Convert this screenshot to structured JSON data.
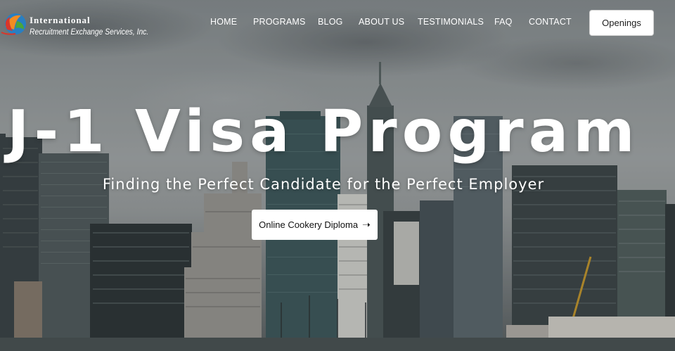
{
  "brand": {
    "line1": "International",
    "line2": "Recruitment Exchange Services, Inc.",
    "colors": {
      "red": "#d8362b",
      "orange": "#f28c22",
      "green": "#4aa63a",
      "blue": "#2a7fc1"
    }
  },
  "nav": {
    "items": [
      {
        "label": "HOME"
      },
      {
        "label": "PROGRAMS"
      },
      {
        "label": "BLOG"
      },
      {
        "label": "ABOUT US"
      },
      {
        "label": "TESTIMONIALS"
      },
      {
        "label": "FAQ"
      },
      {
        "label": "CONTACT"
      }
    ],
    "cta_label": "Openings"
  },
  "hero": {
    "title": "J-1 Visa Program",
    "subtitle": "Finding the Perfect Candidate for the Perfect Employer",
    "cta_label": "Online Cookery Diploma",
    "cta_icon": "arrow-right-icon"
  }
}
